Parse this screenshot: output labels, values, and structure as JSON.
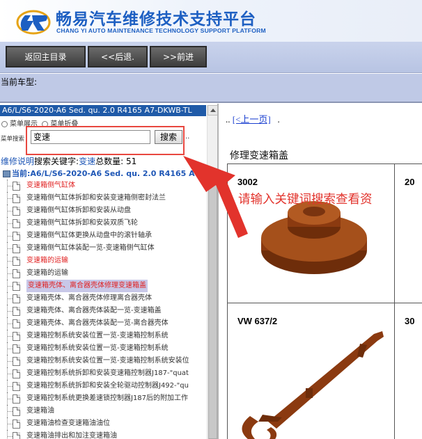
{
  "header": {
    "title": "畅易汽车维修技术支持平台",
    "subtitle": "CHANG YI AUTO MAINTENANCE TECHNOLOGY SUPPORT PLATFORM"
  },
  "toolbar": {
    "home_label": "返回主目录",
    "back_label": "<<后退.",
    "forward_label": ">>前进"
  },
  "model_strip": {
    "label": "当前车型:"
  },
  "sidebar": {
    "model_bar": "A6/L/S6-2020-A6 Sed. qu. 2.0 R4165 A7-DKWB-TL",
    "menu_show": "菜单展示",
    "menu_collapse": "菜单折叠",
    "menu_search_label": "菜单搜索",
    "search_value": "变速",
    "search_button": "搜索",
    "keyword_prefix": "维修说明",
    "keyword_text": "搜索关键字:",
    "keyword_value": "变速",
    "count_text": "总数量:",
    "count_value": "51",
    "root_label": "当前:A6/L/S6-2020-A6 Sed. qu. 2.0 R4165 A",
    "items": [
      {
        "label": "变速箱侧气缸体",
        "style": "red"
      },
      {
        "label": "变速箱侧气缸体拆卸和安装变速箱侧密封法兰",
        "style": "normal"
      },
      {
        "label": "变速箱侧气缸体拆卸和安装从动盘",
        "style": "normal"
      },
      {
        "label": "变速箱侧气缸体拆卸和安装双质飞轮",
        "style": "normal"
      },
      {
        "label": "变速箱侧气缸体更换从动盘中的滚针轴承",
        "style": "normal"
      },
      {
        "label": "变速箱侧气缸体装配一览-变速箱侧气缸体",
        "style": "normal"
      },
      {
        "label": "变速箱的运输",
        "style": "red"
      },
      {
        "label": "变速箱的运输",
        "style": "normal"
      },
      {
        "label": "变速箱壳体、离合器壳体修理变速箱盖",
        "style": "sel"
      },
      {
        "label": "变速箱壳体、离合器壳体修理离合器壳体",
        "style": "normal"
      },
      {
        "label": "变速箱壳体、离合器壳体装配一览-变速箱盖",
        "style": "normal"
      },
      {
        "label": "变速箱壳体、离合器壳体装配一览-离合器壳体",
        "style": "normal"
      },
      {
        "label": "变速箱控制系统安装位置一览-变速箱控制系统",
        "style": "normal"
      },
      {
        "label": "变速箱控制系统安装位置一览-变速箱控制系统",
        "style": "normal"
      },
      {
        "label": "变速箱控制系统安装位置一览-变速箱控制系统安装位",
        "style": "normal"
      },
      {
        "label": "变速箱控制系统拆卸和安装变速箱控制器J187-\"quat",
        "style": "normal"
      },
      {
        "label": "变速箱控制系统拆卸和安装全轮驱动控制器J492-\"qu",
        "style": "normal"
      },
      {
        "label": "变速箱控制系统更换差速锁控制器J187后的附加工作",
        "style": "normal"
      },
      {
        "label": "变速箱油",
        "style": "normal"
      },
      {
        "label": "变速箱油检查变速箱油油位",
        "style": "normal"
      },
      {
        "label": "变速箱油排出和加注变速箱油",
        "style": "normal"
      }
    ]
  },
  "content": {
    "nav_prefix": "..",
    "nav_prev": "[<上一页]",
    "nav_suffix": ".",
    "heading": "修理变速箱盖",
    "cells": [
      {
        "label": "3002"
      },
      {
        "label": "20"
      },
      {
        "label": "VW 637/2"
      },
      {
        "label": "30"
      }
    ]
  },
  "annotation": {
    "hint": "请输入关键词搜索查看资",
    "color": "#e2332c"
  },
  "colors": {
    "brand": "#1d5fc2",
    "model_bar": "#1f5aa8",
    "tool_brown": "#8b3a10"
  }
}
